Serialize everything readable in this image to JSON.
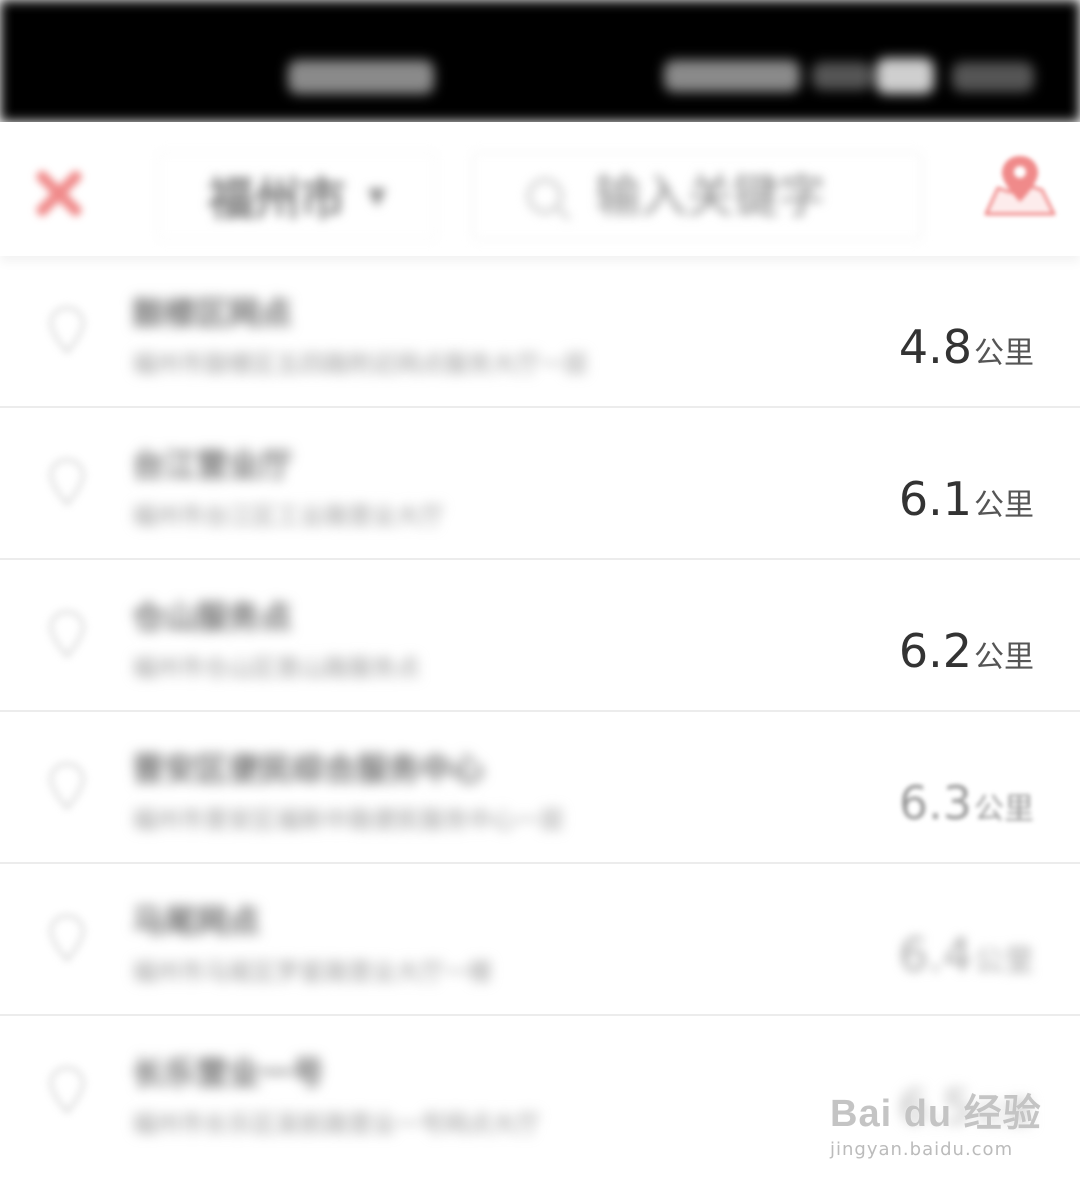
{
  "header": {
    "city": "福州市",
    "search_placeholder": "输入关键字"
  },
  "colors": {
    "accent": "#f08a8a",
    "status_bar": "#000000"
  },
  "icons": {
    "close": "close-icon",
    "chevron": "chevron-down-icon",
    "search": "search-icon",
    "map": "map-pin-icon",
    "row_pin": "location-pin-icon"
  },
  "list": {
    "items": [
      {
        "name": "鼓楼区网点",
        "addr": "福州市鼓楼区五四路附近网点服务大厅一层",
        "distance_value": "4.8",
        "distance_unit": "公里"
      },
      {
        "name": "台江营业厅",
        "addr": "福州市台江区工业路营业大厅",
        "distance_value": "6.1",
        "distance_unit": "公里"
      },
      {
        "name": "仓山服务点",
        "addr": "福州市仓山区首山路服务点",
        "distance_value": "6.2",
        "distance_unit": "公里"
      },
      {
        "name": "晋安区便民综合服务中心",
        "addr": "福州市晋安区福新中路便民服务中心一层",
        "distance_value": "6.3",
        "distance_unit": "公里"
      },
      {
        "name": "马尾网点",
        "addr": "福州市马尾区罗星路营业大厅一楼",
        "distance_value": "6.4",
        "distance_unit": "公里"
      },
      {
        "name": "长乐营业一号",
        "addr": "福州市长乐区吴航路营业一号网点大厅",
        "distance_value": "6.5",
        "distance_unit": "公里"
      }
    ]
  },
  "watermark": {
    "brand": "Bai du 经验",
    "site": "jingyan.baidu.com"
  }
}
